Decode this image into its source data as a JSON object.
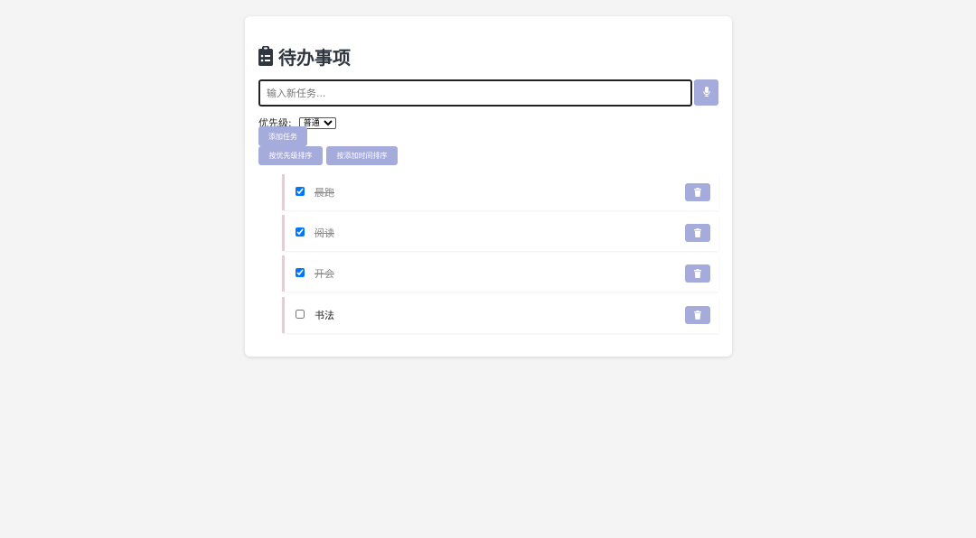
{
  "app": {
    "title": "待办事项",
    "title_icon": "clipboard-list-icon"
  },
  "input": {
    "placeholder": "输入新任务...",
    "value": "",
    "voice_icon": "microphone-icon"
  },
  "priority": {
    "label": "优先级:",
    "selected": "普通"
  },
  "buttons": {
    "add": "添加任务",
    "sort_priority": "按优先级排序",
    "sort_time": "按添加时间排序"
  },
  "tasks": [
    {
      "text": "晨跑",
      "completed": true
    },
    {
      "text": "阅读",
      "completed": true
    },
    {
      "text": "开会",
      "completed": true
    },
    {
      "text": "书法",
      "completed": false
    }
  ],
  "colors": {
    "accent": "#a5abdb",
    "task_border": "#e3cfd3",
    "background": "#f4f4f4",
    "card": "#ffffff"
  }
}
